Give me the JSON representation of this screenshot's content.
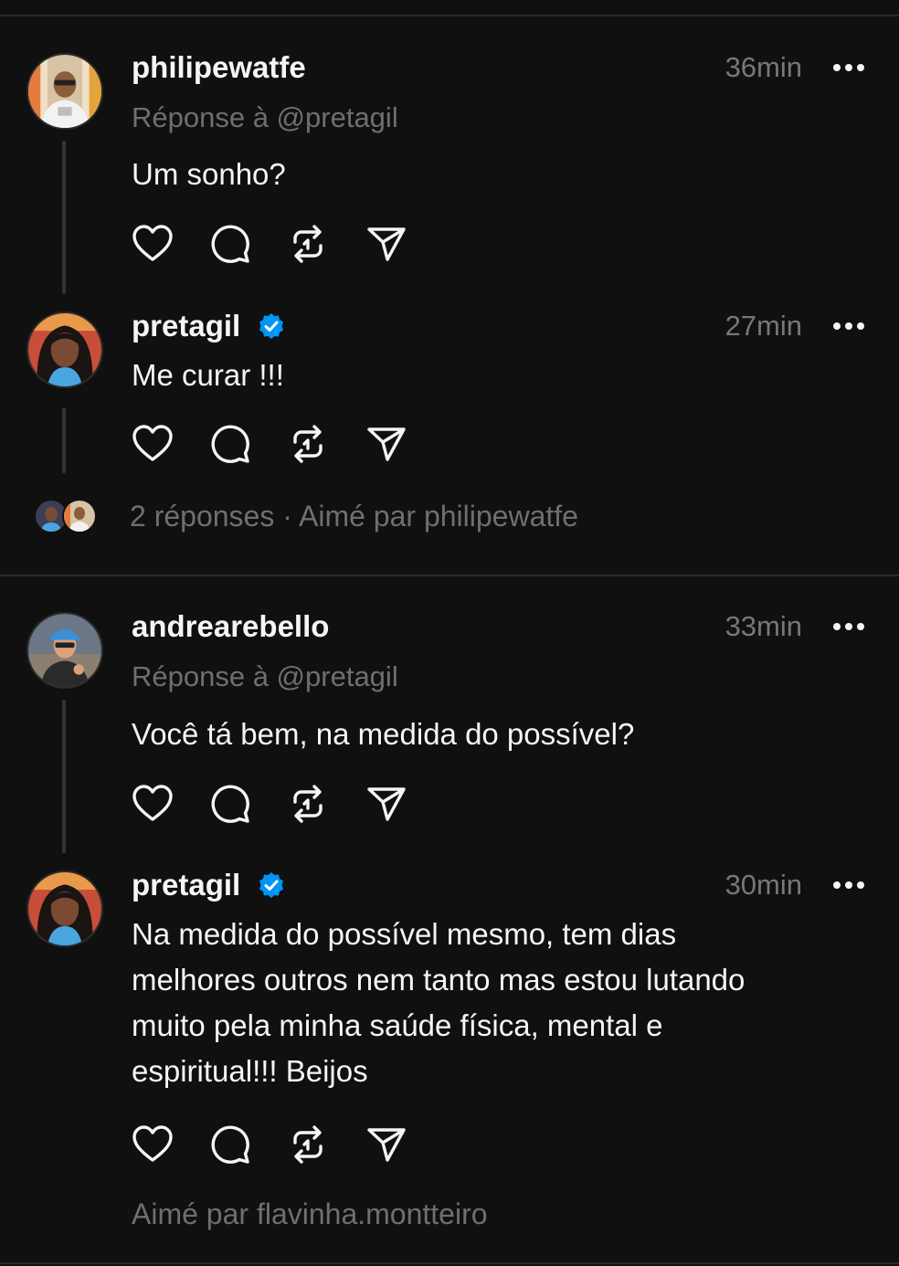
{
  "posts": [
    {
      "username": "philipewatfe",
      "time": "36min",
      "reply_to": "Réponse à @pretagil",
      "text": "Um sonho?",
      "verified": false
    },
    {
      "username": "pretagil",
      "time": "27min",
      "text": "Me curar !!!",
      "verified": true,
      "meta": "2 réponses · Aimé par philipewatfe"
    },
    {
      "username": "andrearebello",
      "time": "33min",
      "reply_to": "Réponse à @pretagil",
      "text": "Você tá bem, na medida do possível?",
      "verified": false
    },
    {
      "username": "pretagil",
      "time": "30min",
      "text": "Na medida do possível mesmo, tem dias\nmelhores outros nem tanto mas estou lutando\nmuito pela minha saúde física, mental e\nespiritual!!! Beijos",
      "verified": true,
      "meta": "Aimé par flavinha.montteiro"
    }
  ],
  "icons": {
    "like": "heart-icon",
    "comment": "comment-icon",
    "repost": "repost-icon",
    "share": "send-icon",
    "more": "more-icon",
    "verified": "verified-badge-icon"
  },
  "colors": {
    "background": "#101010",
    "text": "#f3f5f7",
    "secondary": "#777777",
    "verified": "#0095f6"
  }
}
